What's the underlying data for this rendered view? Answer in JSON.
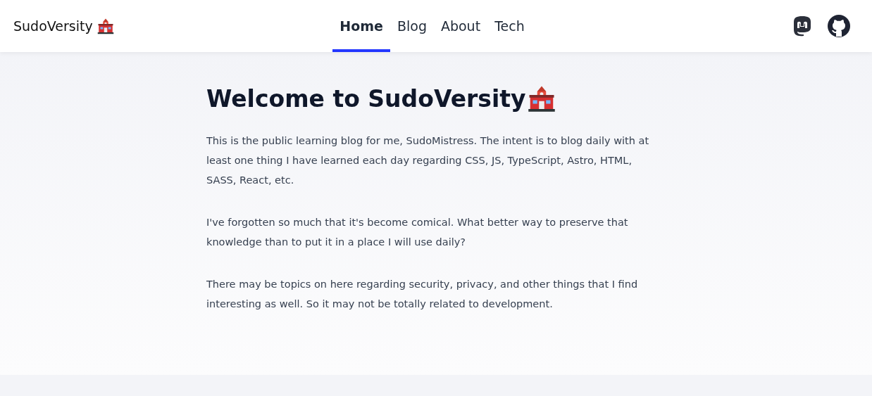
{
  "site_title": "SudoVersity",
  "nav": [
    {
      "label": "Home",
      "selected": true
    },
    {
      "label": "Blog",
      "selected": false
    },
    {
      "label": "About",
      "selected": false
    },
    {
      "label": "Tech",
      "selected": false
    }
  ],
  "heading": "Welcome to SudoVersity",
  "paragraphs": [
    "This is the public learning blog for me, SudoMistress. The intent is to blog daily with at least one thing I have learned each day regarding CSS, JS, TypeScript, Astro, HTML, SASS, React, etc.",
    "I've forgotten so much that it's become comical. What better way to preserve that knowledge than to put it in a place I will use daily?",
    "There may be topics on here regarding security, privacy, and other things that I find interesting as well. So it may not be totally related to development."
  ]
}
